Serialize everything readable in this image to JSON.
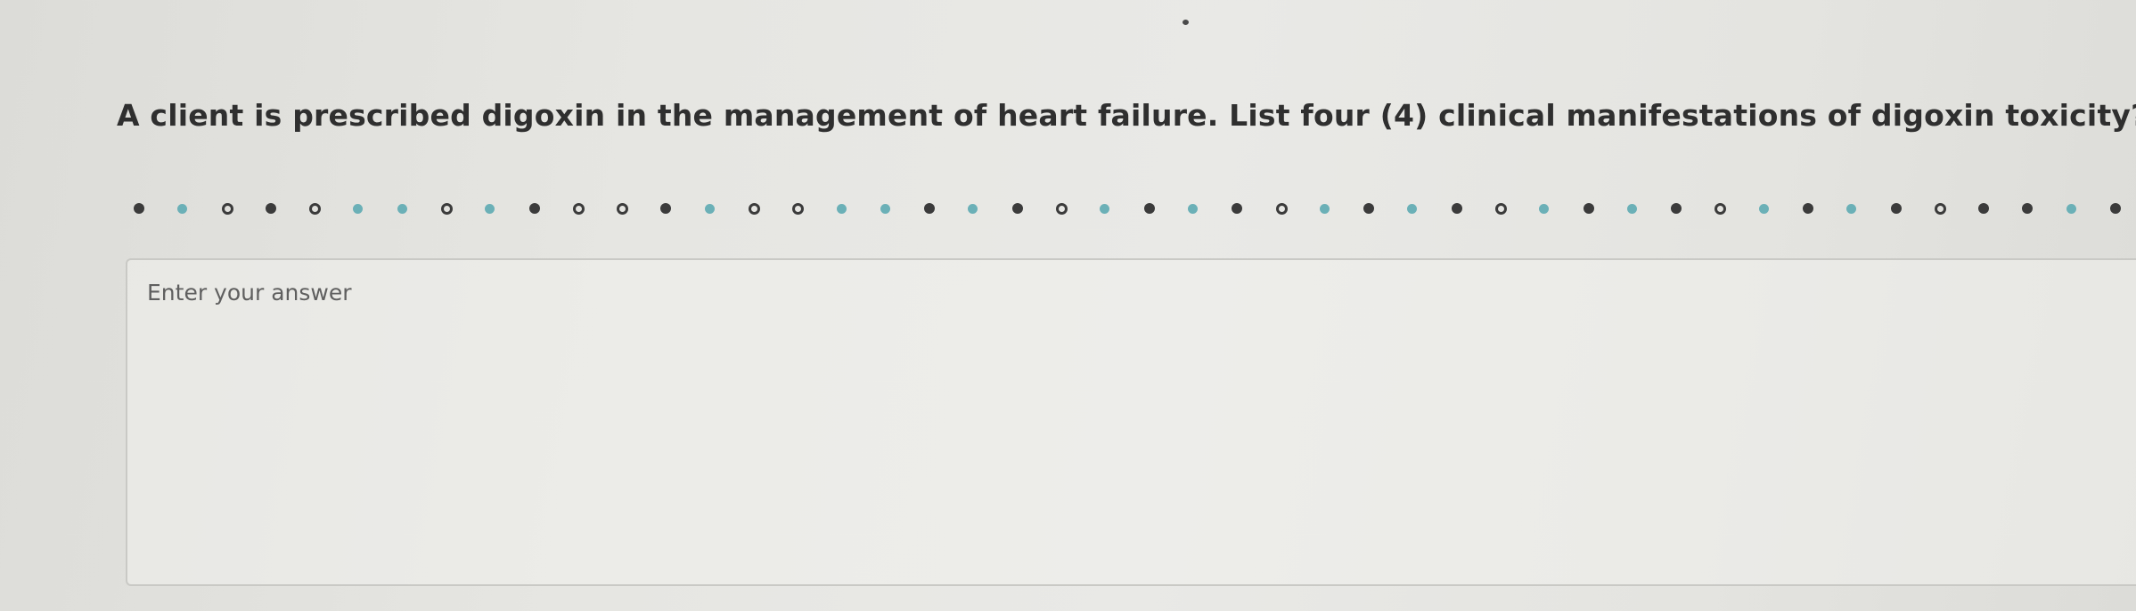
{
  "question": {
    "text": "A client is prescribed digoxin in the management of heart failure.  List four (4) clinical manifestations of digoxin toxicity?"
  },
  "divider": {
    "pattern": [
      "solid",
      "teal",
      "ring",
      "solid",
      "ring",
      "teal",
      "teal",
      "ring",
      "teal",
      "solid",
      "ring",
      "ring",
      "solid",
      "teal",
      "ring",
      "ring",
      "teal",
      "teal",
      "solid",
      "teal",
      "solid",
      "ring",
      "teal",
      "solid",
      "teal",
      "solid",
      "ring",
      "teal",
      "solid",
      "teal",
      "solid",
      "ring",
      "teal",
      "solid",
      "teal",
      "solid",
      "ring",
      "teal",
      "solid",
      "teal",
      "solid",
      "ring",
      "solid",
      "solid",
      "teal",
      "solid"
    ],
    "colors": {
      "dark": "#3b3b3b",
      "teal": "#6bb0b7"
    }
  },
  "answer": {
    "placeholder": "Enter your answer",
    "value": ""
  }
}
